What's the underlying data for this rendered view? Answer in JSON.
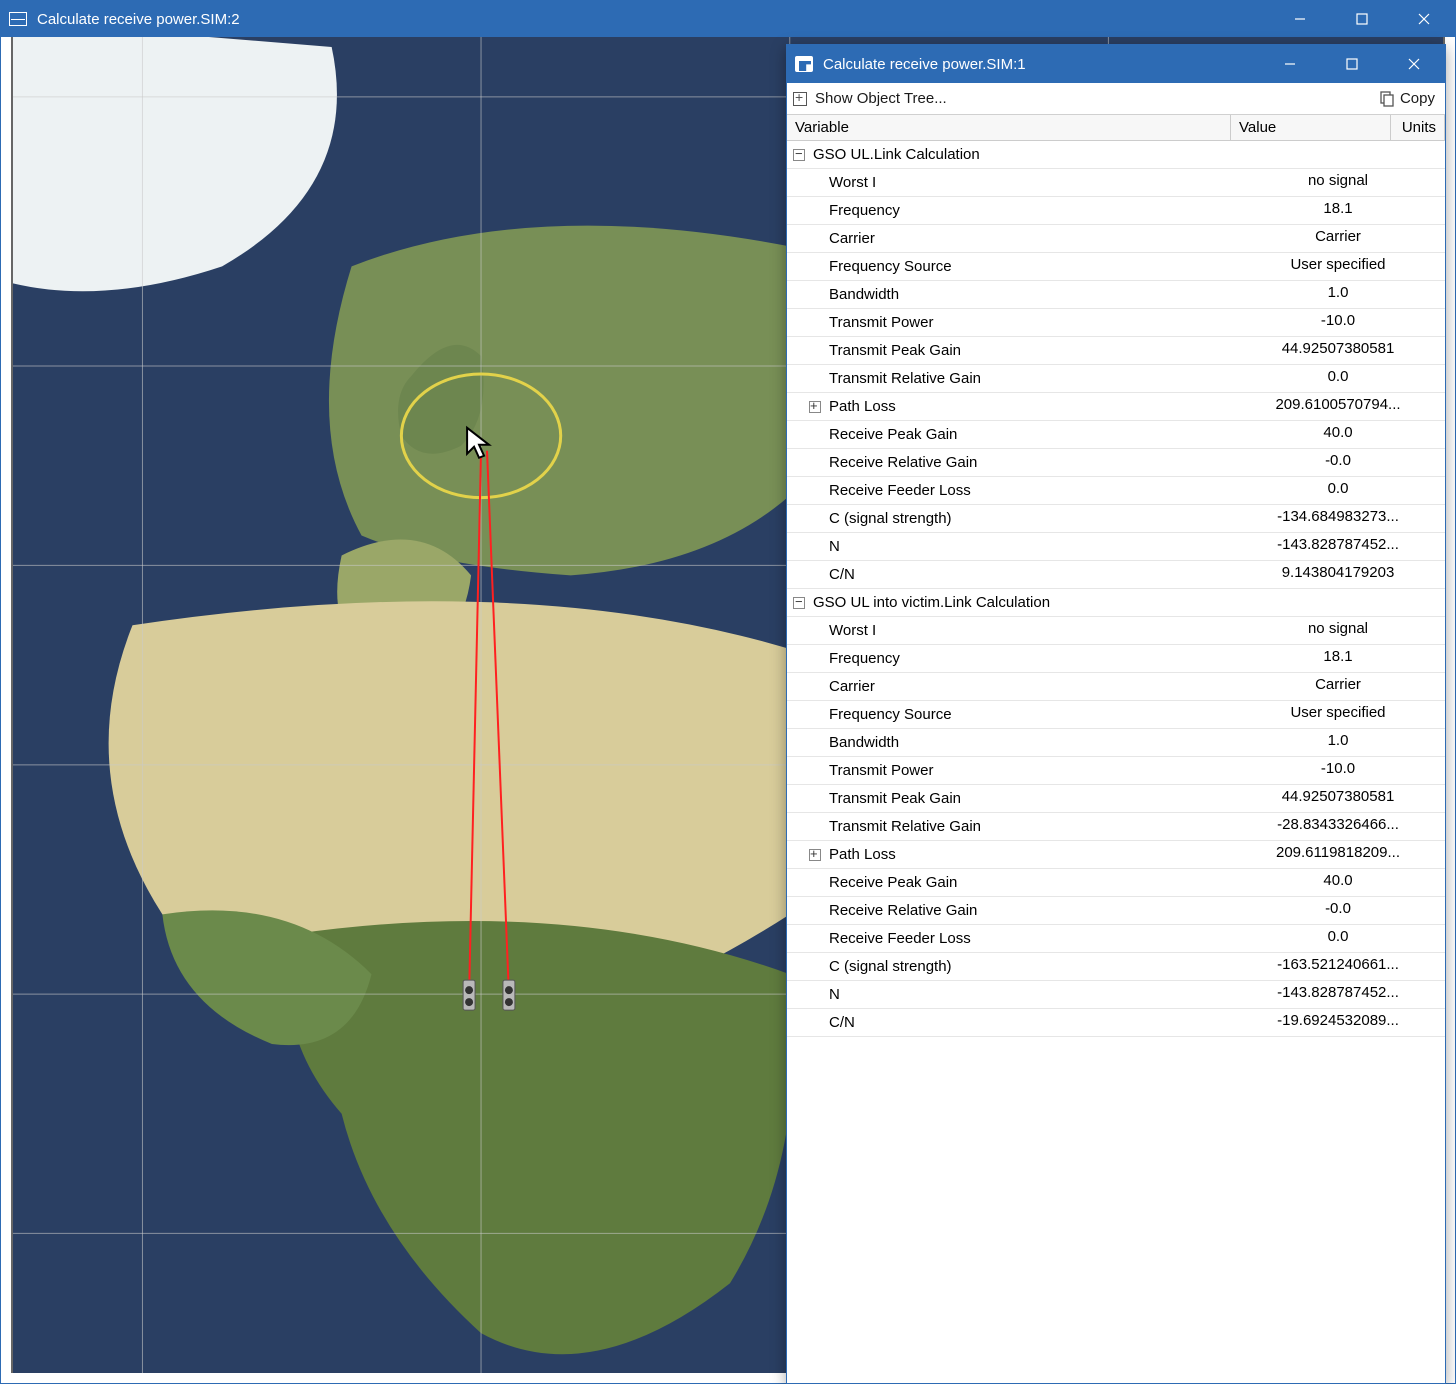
{
  "outer_window": {
    "title": "Calculate receive power.SIM:2"
  },
  "inner_window": {
    "title": "Calculate receive power.SIM:1"
  },
  "toolbar": {
    "show_object_tree": "Show Object Tree...",
    "copy_label": "Copy"
  },
  "columns": {
    "variable": "Variable",
    "value": "Value",
    "units": "Units"
  },
  "groups": [
    {
      "name": "GSO UL.Link Calculation",
      "rows": [
        {
          "label": "Worst I",
          "value": "no signal"
        },
        {
          "label": "Frequency",
          "value": "18.1"
        },
        {
          "label": "Carrier",
          "value": "Carrier"
        },
        {
          "label": "Frequency Source",
          "value": "User specified"
        },
        {
          "label": "Bandwidth",
          "value": "1.0"
        },
        {
          "label": "Transmit Power",
          "value": "-10.0"
        },
        {
          "label": "Transmit Peak Gain",
          "value": "44.92507380581"
        },
        {
          "label": "Transmit Relative Gain",
          "value": "0.0"
        },
        {
          "label": "Path Loss",
          "value": "209.6100570794...",
          "expandable": true
        },
        {
          "label": "Receive Peak Gain",
          "value": "40.0"
        },
        {
          "label": "Receive Relative Gain",
          "value": "-0.0"
        },
        {
          "label": "Receive Feeder Loss",
          "value": "0.0"
        },
        {
          "label": "C (signal strength)",
          "value": "-134.684983273..."
        },
        {
          "label": "N",
          "value": "-143.828787452..."
        },
        {
          "label": "C/N",
          "value": "9.143804179203"
        }
      ]
    },
    {
      "name": "GSO UL into victim.Link Calculation",
      "rows": [
        {
          "label": "Worst I",
          "value": "no signal"
        },
        {
          "label": "Frequency",
          "value": "18.1"
        },
        {
          "label": "Carrier",
          "value": "Carrier"
        },
        {
          "label": "Frequency Source",
          "value": "User specified"
        },
        {
          "label": "Bandwidth",
          "value": "1.0"
        },
        {
          "label": "Transmit Power",
          "value": "-10.0"
        },
        {
          "label": "Transmit Peak Gain",
          "value": "44.92507380581"
        },
        {
          "label": "Transmit Relative Gain",
          "value": "-28.8343326466..."
        },
        {
          "label": "Path Loss",
          "value": "209.6119818209...",
          "expandable": true
        },
        {
          "label": "Receive Peak Gain",
          "value": "40.0"
        },
        {
          "label": "Receive Relative Gain",
          "value": "-0.0"
        },
        {
          "label": "Receive Feeder Loss",
          "value": "0.0"
        },
        {
          "label": "C (signal strength)",
          "value": "-163.521240661..."
        },
        {
          "label": "N",
          "value": "-143.828787452..."
        },
        {
          "label": "C/N",
          "value": "-19.6924532089..."
        }
      ]
    }
  ],
  "map": {
    "gridlines_lon": [
      -60,
      -30,
      0,
      30,
      60
    ],
    "gridlines_lat": [
      75,
      60,
      45,
      30,
      15,
      0,
      -15,
      -30
    ],
    "station": {
      "lon": 0,
      "lat": 50
    },
    "satellites": [
      {
        "lon": -2,
        "lat": 3
      },
      {
        "lon": 2,
        "lat": 3
      }
    ]
  }
}
